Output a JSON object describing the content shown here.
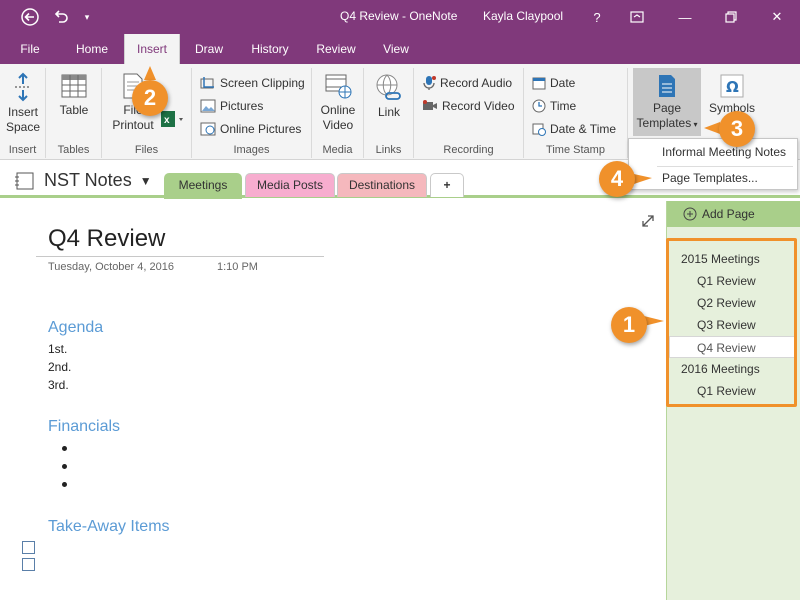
{
  "titlebar": {
    "app_title": "Q4 Review - OneNote",
    "user": "Kayla Claypool",
    "help": "?",
    "minimize": "—",
    "close": "✕"
  },
  "tabs": [
    "File",
    "Home",
    "Insert",
    "Draw",
    "History",
    "Review",
    "View"
  ],
  "ribbon": {
    "insert_space": "Insert Space",
    "table": "Table",
    "file_printout": "File Printout",
    "screen_clipping": "Screen Clipping",
    "pictures": "Pictures",
    "online_pictures": "Online Pictures",
    "online_video": "Online Video",
    "link": "Link",
    "record_audio": "Record Audio",
    "record_video": "Record Video",
    "date": "Date",
    "time": "Time",
    "date_time": "Date & Time",
    "page_templates": "Page Templates",
    "symbols": "Symbols",
    "groups": [
      "Insert",
      "Tables",
      "Files",
      "Images",
      "Media",
      "Links",
      "Recording",
      "Time Stamp"
    ]
  },
  "menu": {
    "items": [
      "Informal Meeting Notes",
      "Page Templates..."
    ]
  },
  "notebook": {
    "name": "NST Notes",
    "sections": [
      "Meetings",
      "Media Posts",
      "Destinations"
    ],
    "add_section": "+"
  },
  "colors": {
    "accent": "#80397b",
    "meetings_tab": "#a9cf8a",
    "media_posts_tab": "#f7adcf",
    "destinations_tab": "#f5b8bd",
    "callout": "#f0912b",
    "heading": "#5b9bd5"
  },
  "page": {
    "title": "Q4 Review",
    "date": "Tuesday, October 4, 2016",
    "time": "1:10 PM",
    "agenda_heading": "Agenda",
    "agenda_items": [
      "1st.",
      "2nd.",
      "3rd."
    ],
    "financials_heading": "Financials",
    "takeaway_heading": "Take-Away Items"
  },
  "pages_pane": {
    "add_page": "Add Page",
    "pages": [
      "2015 Meetings",
      "Q1 Review",
      "Q2 Review",
      "Q3 Review",
      "Q4 Review",
      "2016 Meetings",
      "Q1 Review"
    ]
  },
  "callouts": [
    "1",
    "2",
    "3",
    "4"
  ]
}
